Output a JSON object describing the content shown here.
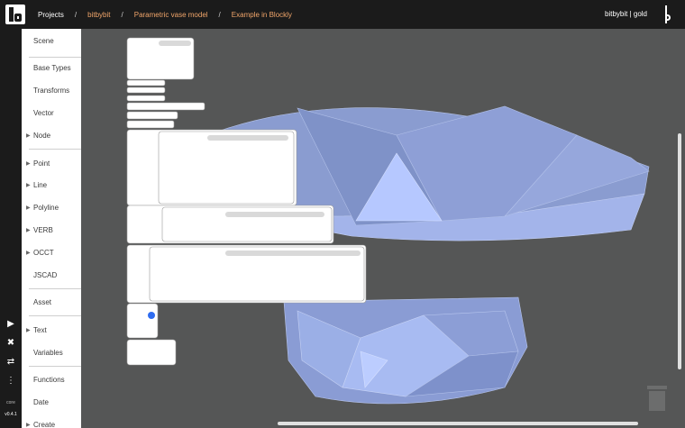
{
  "header": {
    "breadcrumbs": [
      "Projects",
      "bitbybit",
      "Parametric vase model",
      "Example in Blockly"
    ],
    "separator": "/",
    "user": "bitbybit | gold"
  },
  "rail": {
    "buttons": [
      "play-icon",
      "tools-icon",
      "swap-icon",
      "more-vertical-icon"
    ],
    "version_label": "core",
    "version": "v0.4.1"
  },
  "sidebar": {
    "categories": [
      {
        "label": "Scene",
        "expandable": false
      },
      {
        "label": "Base Types",
        "expandable": false
      },
      {
        "label": "Transforms",
        "expandable": false
      },
      {
        "label": "Vector",
        "expandable": false
      },
      {
        "label": "Node",
        "expandable": true
      },
      {
        "label": "Point",
        "expandable": true
      },
      {
        "label": "Line",
        "expandable": true
      },
      {
        "label": "Polyline",
        "expandable": true
      },
      {
        "label": "VERB",
        "expandable": true
      },
      {
        "label": "OCCT",
        "expandable": true
      },
      {
        "label": "JSCAD",
        "expandable": false
      },
      {
        "label": "Asset",
        "expandable": false
      },
      {
        "label": "Text",
        "expandable": true
      },
      {
        "label": "Variables",
        "expandable": false
      },
      {
        "label": "Functions",
        "expandable": false
      },
      {
        "label": "Date",
        "expandable": false
      },
      {
        "label": "Create",
        "expandable": true
      }
    ]
  },
  "colors": {
    "topbar": "#1b1b1b",
    "accent_crumb": "#f0a56a",
    "viewport_bg": "#555656",
    "vase": "#9fb3ec",
    "selected_block": "#2f6cf0"
  }
}
